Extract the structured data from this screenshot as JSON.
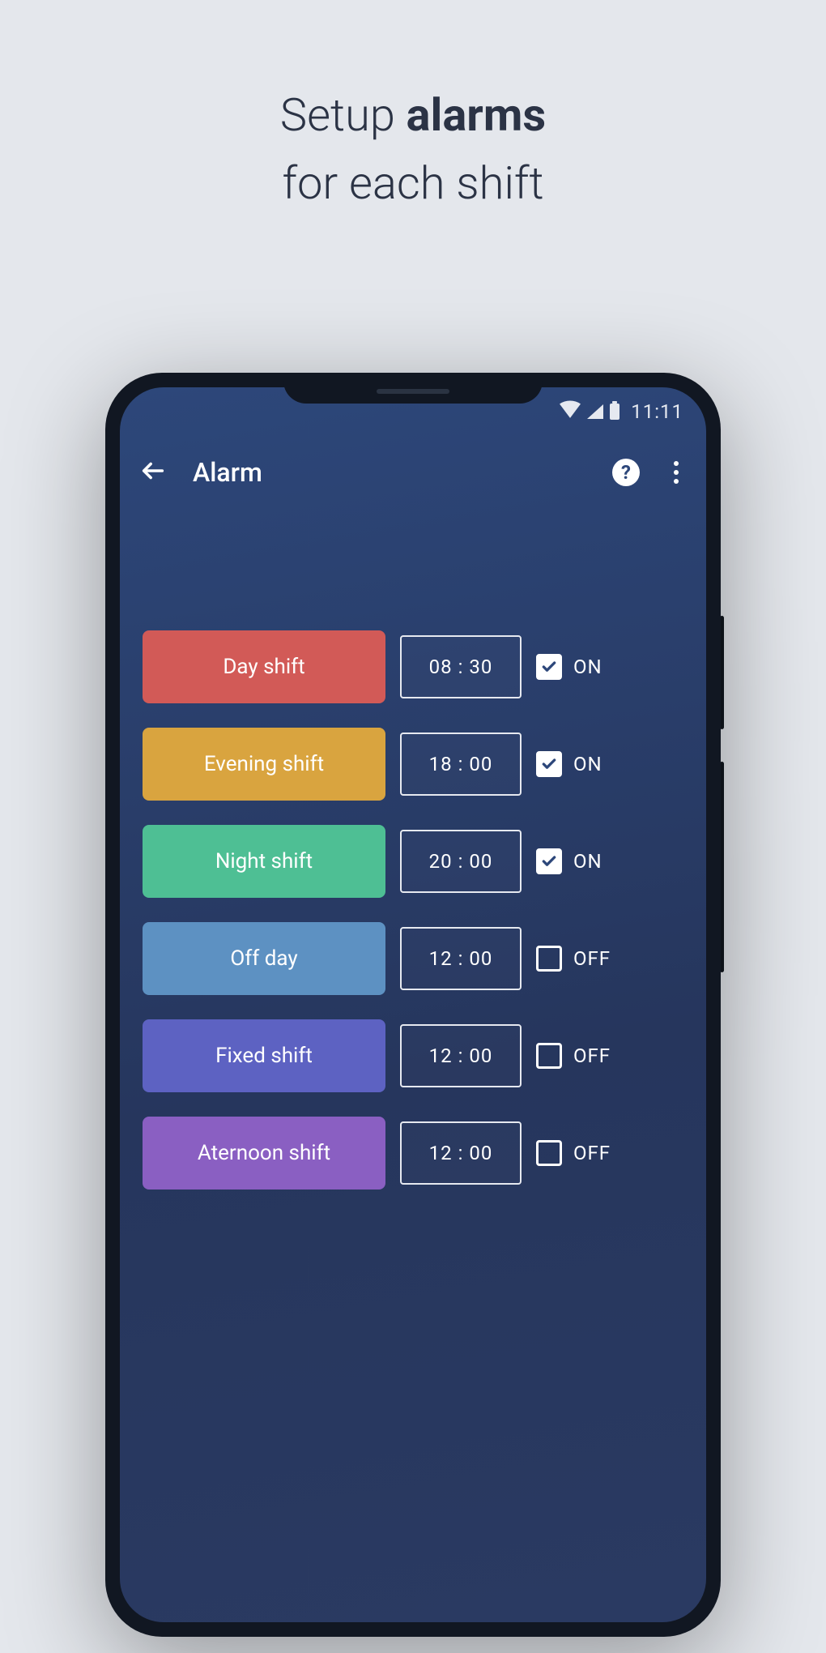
{
  "promo": {
    "line1_a": "Setup ",
    "line1_b": "alarms",
    "line2": "for each shift"
  },
  "status": {
    "time": "11:11"
  },
  "appbar": {
    "title": "Alarm",
    "help_glyph": "?"
  },
  "labels": {
    "on": "ON",
    "off": "OFF"
  },
  "shifts": [
    {
      "name": "Day shift",
      "time": "08 : 30",
      "on": true,
      "color": "#d25a57"
    },
    {
      "name": "Evening shift",
      "time": "18 : 00",
      "on": true,
      "color": "#d9a43f"
    },
    {
      "name": "Night shift",
      "time": "20 : 00",
      "on": true,
      "color": "#4ebf94"
    },
    {
      "name": "Off day",
      "time": "12 : 00",
      "on": false,
      "color": "#5d91c2"
    },
    {
      "name": "Fixed shift",
      "time": "12 : 00",
      "on": false,
      "color": "#5d62c2"
    },
    {
      "name": "Aternoon shift",
      "time": "12 : 00",
      "on": false,
      "color": "#8a5fc2"
    }
  ]
}
